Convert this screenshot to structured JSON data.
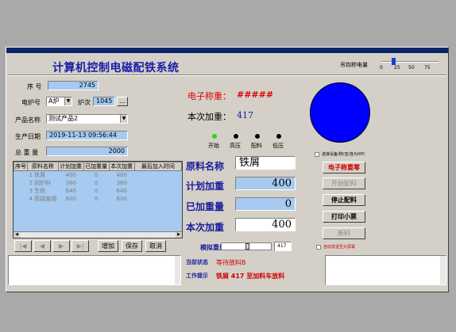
{
  "app": {
    "title": "计算机控制电磁配铁系统"
  },
  "scale": {
    "label": "吊钩称电量",
    "ticks": [
      "0",
      "25",
      "50",
      "75"
    ],
    "level_percent": 22
  },
  "form": {
    "seq_label": "序 号",
    "seq_value": "2745",
    "furnace_label": "电炉号",
    "furnace_value": "A炉",
    "batch_label": "炉次",
    "batch_value": "1045",
    "batch_btn": "...",
    "product_label": "产品名称",
    "product_value": "测试产品2",
    "date_label": "生产日期",
    "date_value": "2019-11-13 09:56:44",
    "total_label": "总 重 量",
    "total_value": "2000"
  },
  "grid": {
    "columns": [
      "序号",
      "原料名称",
      "计划加重",
      "已加重量",
      "本次加重",
      "最后加入时间"
    ],
    "rows": [
      [
        "",
        "1 铁屑",
        "400",
        "0",
        "400",
        ""
      ],
      [
        "",
        "2 回炉料",
        "360",
        "0",
        "360",
        ""
      ],
      [
        "",
        "3 生铁",
        "640",
        "0",
        "640",
        ""
      ],
      [
        "",
        "4 高锰废钢",
        "600",
        "0",
        "600",
        ""
      ]
    ]
  },
  "nav": {
    "first": "|◀",
    "prev": "◀",
    "next": "▶",
    "last": "▶|",
    "add": "增加",
    "save": "保存",
    "cancel": "取消"
  },
  "weigh": {
    "scale_label": "电子称重：",
    "scale_value": "#####",
    "current_label": "本次加重：",
    "current_value": "417"
  },
  "lamps": [
    {
      "label": "开始",
      "color": "#22dd22"
    },
    {
      "label": "高压",
      "color": "#000000"
    },
    {
      "label": "配料",
      "color": "#000000"
    },
    {
      "label": "低压",
      "color": "#000000"
    }
  ],
  "material": {
    "name_label": "原料名称",
    "name_value": "铁屑",
    "plan_label": "计划加重",
    "plan_value": "400",
    "added_label": "已加重量",
    "added_value": "0",
    "this_label": "本次加重",
    "this_value": "400"
  },
  "sim": {
    "label": "模拟重量",
    "value": "417"
  },
  "options": {
    "connect_label": "连接设备/称/亚/连为0PC",
    "auto_label": "自动发送至大屏幕"
  },
  "buttons": {
    "zero": "电子称重零",
    "start": "开始配料",
    "stop": "停止配料",
    "print": "打印小票",
    "new": "新料"
  },
  "status": {
    "state_label": "当前状态",
    "state_value": "等待放料B",
    "hint_label": "工作提示",
    "hint_value": "铁屑 417 至加料车放料"
  }
}
